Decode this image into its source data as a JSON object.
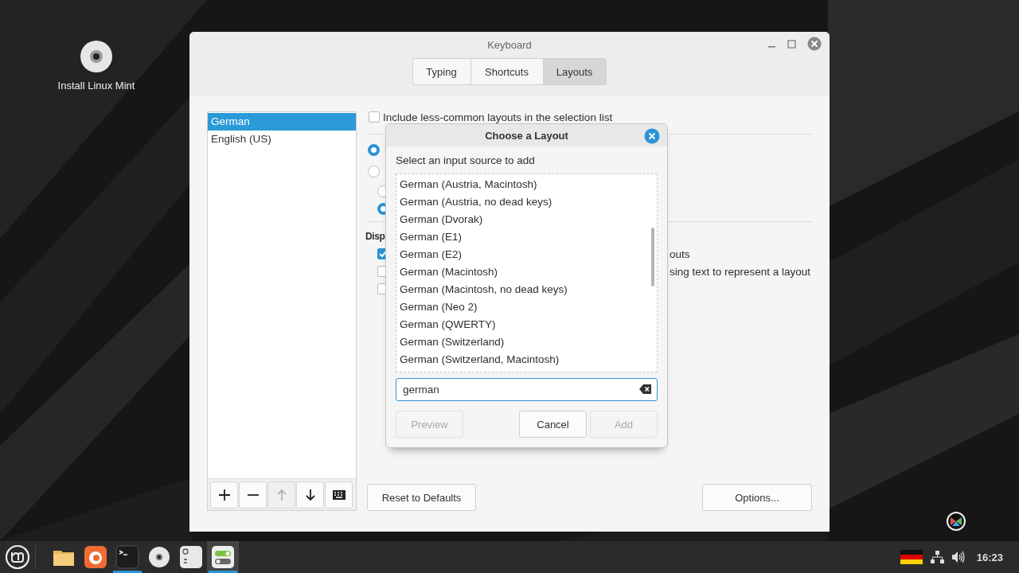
{
  "desktop": {
    "icons": [
      {
        "label": "Install Linux Mint"
      }
    ]
  },
  "keyboard_window": {
    "title": "Keyboard",
    "tabs": [
      {
        "label": "Typing",
        "selected": false
      },
      {
        "label": "Shortcuts",
        "selected": false
      },
      {
        "label": "Layouts",
        "selected": true
      }
    ],
    "layouts": [
      {
        "label": "German",
        "selected": true
      },
      {
        "label": "English (US)",
        "selected": false
      }
    ],
    "list_toolbar": [
      {
        "kind": "add",
        "disabled": false
      },
      {
        "kind": "remove",
        "disabled": false
      },
      {
        "kind": "up",
        "disabled": true
      },
      {
        "kind": "down",
        "disabled": false
      },
      {
        "kind": "keyboard",
        "disabled": false
      }
    ],
    "include_less_common": {
      "label": "Include less-common layouts in the selection list",
      "checked": false
    },
    "radios": [
      {
        "selected": true
      },
      {
        "selected": false
      }
    ],
    "sub_radios": [
      {
        "selected": false
      },
      {
        "selected": true
      }
    ],
    "display_heading": "Disp",
    "display_checkboxes": [
      {
        "label": "outs",
        "checked": true
      },
      {
        "label": "sing text to represent a layout",
        "checked": false
      },
      {
        "checked": false
      }
    ],
    "reset_button": "Reset to Defaults",
    "options_button": "Options..."
  },
  "dialog": {
    "title": "Choose a Layout",
    "prompt": "Select an input source to add",
    "items": [
      "German (Austria, Macintosh)",
      "German (Austria, no dead keys)",
      "German (Dvorak)",
      "German (E1)",
      "German (E2)",
      "German (Macintosh)",
      "German (Macintosh, no dead keys)",
      "German (Neo 2)",
      "German (QWERTY)",
      "German (Switzerland)",
      "German (Switzerland, Macintosh)"
    ],
    "search": {
      "value": "german"
    },
    "buttons": [
      {
        "label": "Preview",
        "disabled": true
      },
      {
        "label": "Cancel",
        "disabled": false
      },
      {
        "label": "Add",
        "disabled": true
      }
    ]
  },
  "taskbar": {
    "launchers": [
      {
        "kind": "folder",
        "running": false,
        "selected": false
      },
      {
        "kind": "browser",
        "running": false,
        "selected": false
      },
      {
        "kind": "terminal",
        "running": true,
        "selected": false
      },
      {
        "kind": "disc",
        "running": false,
        "selected": false
      },
      {
        "kind": "notes",
        "running": false,
        "selected": false
      },
      {
        "kind": "toggles",
        "running": true,
        "selected": true
      }
    ],
    "clock": "16:23"
  }
}
